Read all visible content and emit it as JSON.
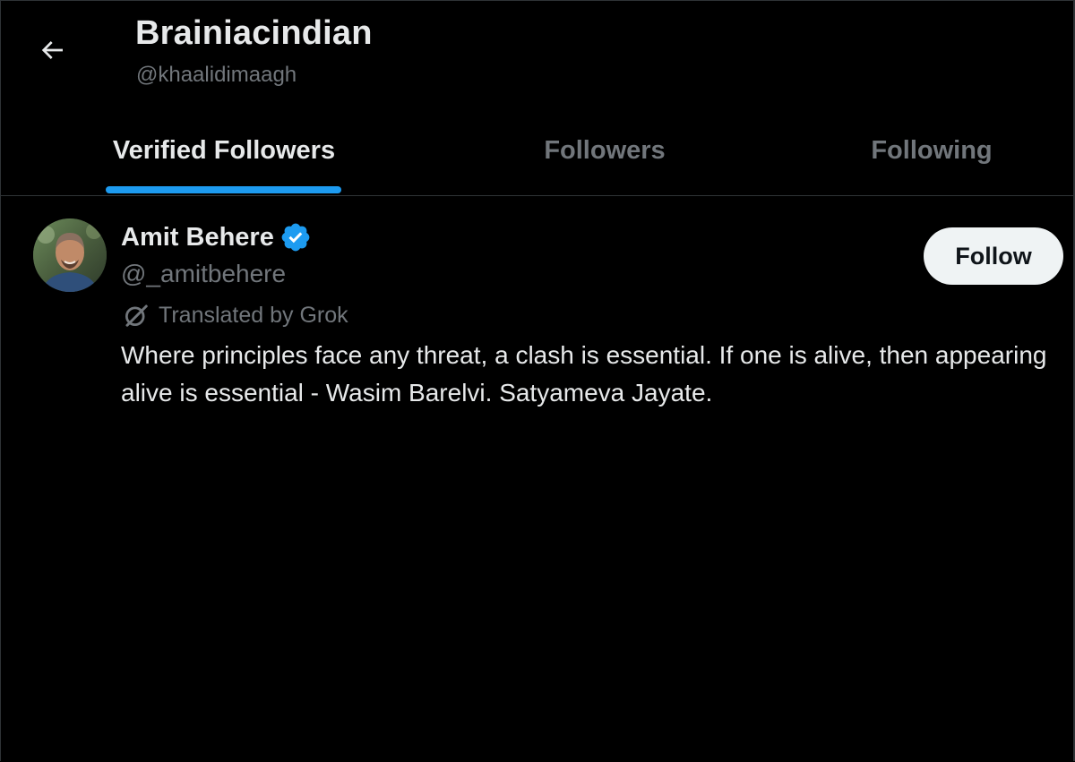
{
  "header": {
    "title": "Brainiacindian",
    "handle": "@khaalidimaagh",
    "back_icon": "arrow-left-icon"
  },
  "tabs": [
    {
      "label": "Verified Followers",
      "active": true
    },
    {
      "label": "Followers",
      "active": false
    },
    {
      "label": "Following",
      "active": false
    }
  ],
  "colors": {
    "background": "#000000",
    "text_primary": "#e7e9ea",
    "text_secondary": "#71767b",
    "accent": "#1d9bf0",
    "follow_button_bg": "#eff3f4",
    "divider": "#2f3336"
  },
  "user_list": [
    {
      "name": "Amit Behere",
      "verified": true,
      "handle": "@_amitbehere",
      "translated_label": "Translated by Grok",
      "bio": "Where principles face any threat, a clash is essential. If one is alive, then appearing alive is essential - Wasim Barelvi. Satyameva Jayate.",
      "follow_label": "Follow"
    }
  ]
}
